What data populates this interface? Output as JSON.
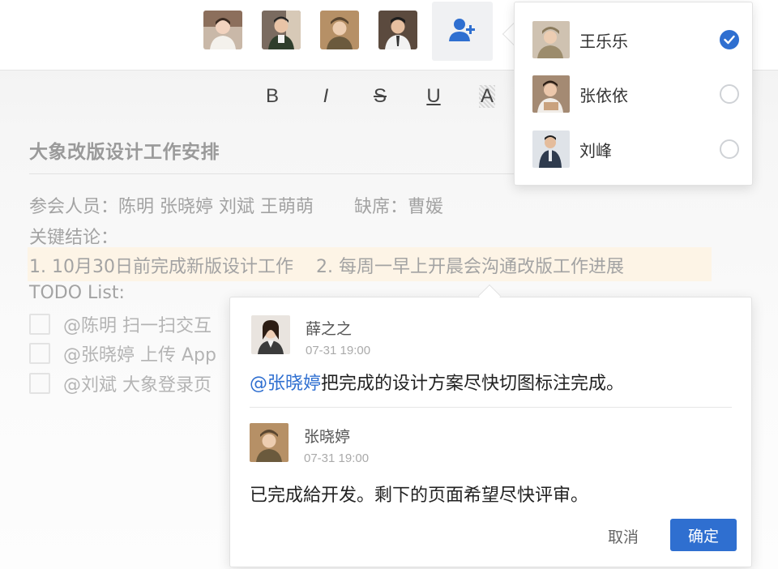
{
  "avatar_bar": {
    "members": [
      {
        "id": "avatar-woman-apron"
      },
      {
        "id": "avatar-barista"
      },
      {
        "id": "avatar-worker-cap"
      },
      {
        "id": "avatar-man-suit"
      }
    ],
    "add_icon": "user-plus-icon"
  },
  "toolbar": {
    "bold": "B",
    "italic": "I",
    "strike": "S",
    "underline": "U",
    "color": "A"
  },
  "document": {
    "title": "大象改版设计工作安排",
    "attendees_label": "参会人员：陈明 张晓婷 刘斌 王萌萌",
    "absent_label": "缺席：曹媛",
    "conclusion_label": "关键结论：",
    "conclusion_item1": "1. 10月30日前完成新版设计工作",
    "conclusion_item2": "2. 每周一早上开晨会沟通改版工作进展",
    "todo_title": "TODO List:",
    "todos": [
      {
        "text": "@陈明 扫一扫交互"
      },
      {
        "text": "@张晓婷 上传 App"
      },
      {
        "text": "@刘斌 大象登录页"
      }
    ]
  },
  "member_picker": {
    "members": [
      {
        "name": "王乐乐",
        "checked": true
      },
      {
        "name": "张依依",
        "checked": false
      },
      {
        "name": "刘峰",
        "checked": false
      }
    ]
  },
  "comments": {
    "items": [
      {
        "author": "薛之之",
        "time": "07-31 19:00",
        "mention": "@张晓婷",
        "text": "把完成的设计方案尽快切图标注完成。"
      },
      {
        "author": "张晓婷",
        "time": "07-31 19:00",
        "mention": "",
        "text": "已完成給开发。剩下的页面希望尽快评审。"
      }
    ],
    "cancel_label": "取消",
    "confirm_label": "确定"
  },
  "colors": {
    "accent": "#2f6fd0",
    "highlight": "#fdf4e6"
  }
}
